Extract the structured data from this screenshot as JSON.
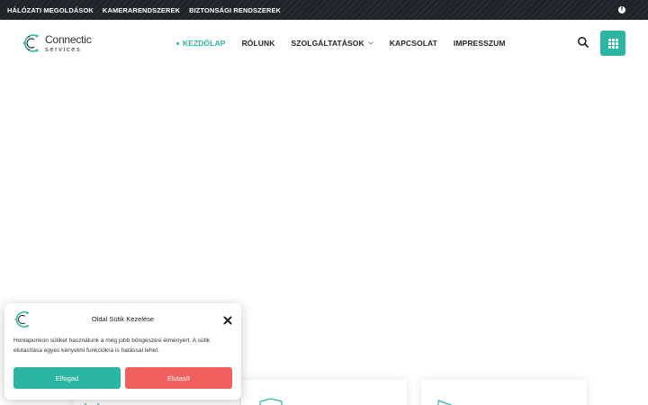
{
  "topbar": {
    "links": [
      "HÁLÓZATI MEGOLDÁSOK",
      "KAMERARENDSZEREK",
      "BIZTONSÁGI RENDSZEREK"
    ],
    "social_icon": "facebook-icon"
  },
  "header": {
    "logo": {
      "brand": "Connectic",
      "sub": "services"
    },
    "nav": {
      "home": "KEZDŐLAP",
      "about": "RÓLUNK",
      "services": "SZOLGÁLTATÁSOK",
      "contact": "KAPCSOLAT",
      "impressum": "IMPRESSZUM"
    },
    "search_icon": "search-icon",
    "menu_icon": "grid-icon"
  },
  "cookie": {
    "title": "Oldal Sütik Kezelése",
    "text": "Honlapunkon sütiket használunk a még jobb böngészési élményért. A sütik elutasítása egyes kényelmi funkciókra is hatással lehet.",
    "accept": "Elfogad",
    "reject": "Elutasít"
  },
  "colors": {
    "accent": "#2bb5a3",
    "reject": "#f0605f",
    "topbar": "#1f2227"
  }
}
